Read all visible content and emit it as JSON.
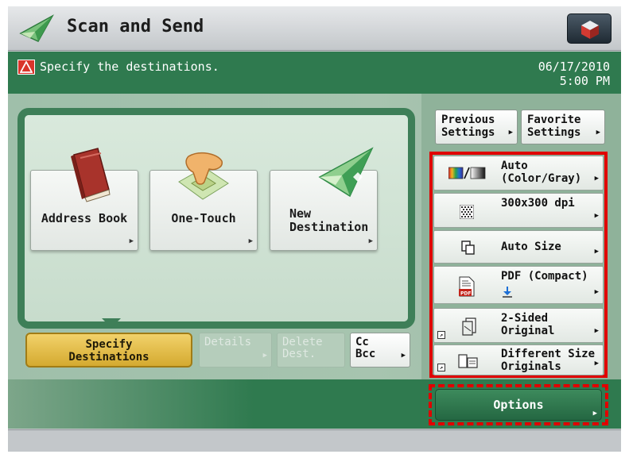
{
  "header": {
    "title": "Scan and Send"
  },
  "status": {
    "message": "Specify the destinations.",
    "date": "06/17/2010",
    "time": "5:00 PM"
  },
  "destinations": {
    "address_book": "Address Book",
    "one_touch": "One-Touch",
    "new_destination_line1": "New",
    "new_destination_line2": "Destination"
  },
  "tabs": {
    "specify_line1": "Specify",
    "specify_line2": "Destinations",
    "details": "Details",
    "delete_line1": "Delete",
    "delete_line2": "Dest.",
    "cc": "Cc",
    "bcc": "Bcc"
  },
  "quick_settings": {
    "previous_line1": "Previous",
    "previous_line2": "Settings",
    "favorite_line1": "Favorite",
    "favorite_line2": "Settings"
  },
  "settings": {
    "color_line1": "Auto",
    "color_line2": "(Color/Gray)",
    "resolution": "300x300 dpi",
    "size": "Auto Size",
    "format": "PDF (Compact)",
    "two_sided_line1": "2-Sided",
    "two_sided_line2": "Original",
    "diff_size_line1": "Different Size",
    "diff_size_line2": "Originals"
  },
  "options": {
    "label": "Options"
  },
  "icons": {
    "app": "send-plane-icon",
    "top_right": "box-icon",
    "warning": "warning-icon",
    "address_book": "book-icon",
    "one_touch": "hand-press-icon",
    "new_destination": "paper-plane-icon",
    "color": "color-gray-icon",
    "resolution": "dot-pattern-icon",
    "size": "auto-size-icon",
    "format": "pdf-file-icon",
    "two_sided": "two-sided-original-icon",
    "diff_size": "different-size-originals-icon"
  },
  "colors": {
    "status_bar": "#2f7a4f",
    "panel_border": "#3e7f58",
    "selected_tab": "#e8c54f",
    "highlight": "#e00000",
    "options_button": "#2f7a4f"
  }
}
